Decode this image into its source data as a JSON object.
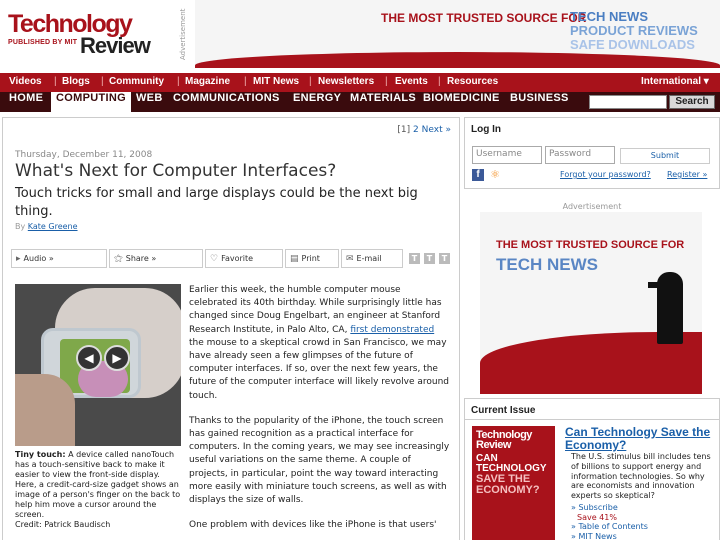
{
  "masthead": {
    "logo_line1": "Technology",
    "logo_line2": "PUBLISHED BY MIT",
    "logo_line3": "Review",
    "ad_label": "Advertisement",
    "banner_trusted": "THE MOST TRUSTED SOURCE FOR",
    "banner_items": [
      "TECH NEWS",
      "PRODUCT REVIEWS",
      "SAFE DOWNLOADS"
    ]
  },
  "nav_top": {
    "items": [
      "Videos",
      "Blogs",
      "Community",
      "Magazine",
      "MIT News",
      "Newsletters",
      "Events",
      "Resources"
    ],
    "international": "International ▾"
  },
  "nav_main": {
    "items": [
      "HOME",
      "COMPUTING",
      "WEB",
      "COMMUNICATIONS",
      "ENERGY",
      "MATERIALS",
      "BIOMEDICINE",
      "BUSINESS"
    ],
    "active": "COMPUTING",
    "search_label": "Search"
  },
  "article": {
    "pagination": {
      "current": "[1]",
      "next_page": "2",
      "next": "Next »"
    },
    "date": "Thursday, December 11, 2008",
    "title": "What's Next for Computer Interfaces?",
    "subtitle": "Touch tricks for small and large displays could be the next big thing.",
    "byline_prefix": "By",
    "author": "Kate Greene",
    "tools": [
      "Audio »",
      "Share »",
      "Favorite",
      "Print",
      "E-mail"
    ],
    "caption_label": "Tiny touch:",
    "caption_text": "A device called nanoTouch has a touch-sensitive back to make it easier to view the front-side display. Here, a credit-card-size gadget shows an image of a person's finger on the back to help him move a cursor around the screen.",
    "caption_credit": "Credit: Patrick Baudisch",
    "p1_before": "Earlier this week, the humble computer mouse celebrated its 40th birthday. While surprisingly little has changed since Doug Engelbart, an engineer at Stanford Research Institute, in Palo Alto, CA,",
    "p1_link": "first demonstrated",
    "p1_after": "the mouse to a skeptical crowd in San Francisco, we may have already seen a few glimpses of the future of computer interfaces. If so, over the next few years, the future of the computer interface will likely revolve around touch.",
    "p2": "Thanks to the popularity of the iPhone, the touch screen has gained recognition as a practical interface for computers. In the coming years, we may see increasingly useful variations on the same theme. A couple of projects, in particular, point the way toward interacting more easily with miniature touch screens, as well as with displays the size of walls.",
    "p3": "One problem with devices like the iPhone is that users'"
  },
  "login": {
    "title": "Log In",
    "username_placeholder": "Username",
    "password_placeholder": "Password",
    "submit": "Submit",
    "forgot": "Forgot your password?",
    "register": "Register »"
  },
  "side_ad": {
    "label": "Advertisement",
    "line1": "THE MOST TRUSTED SOURCE FOR",
    "line2": "TECH NEWS"
  },
  "current_issue": {
    "title": "Current Issue",
    "cover_logo": "Technology Review",
    "cover_line1": "CAN TECHNOLOGY",
    "cover_line2": "SAVE THE ECONOMY?",
    "headline": "Can Technology Save the Economy?",
    "description": "The U.S. stimulus bill includes tens of billions to support energy and information technologies. So why are economists and innovation experts so skeptical?",
    "subscribe": "» Subscribe",
    "save": "Save 41%",
    "toc": "» Table of Contents",
    "mit_news": "» MIT News"
  },
  "colors": {
    "brand_red": "#a8121b",
    "dark_nav": "#3a0b0d",
    "link_blue": "#1a5fa8"
  }
}
